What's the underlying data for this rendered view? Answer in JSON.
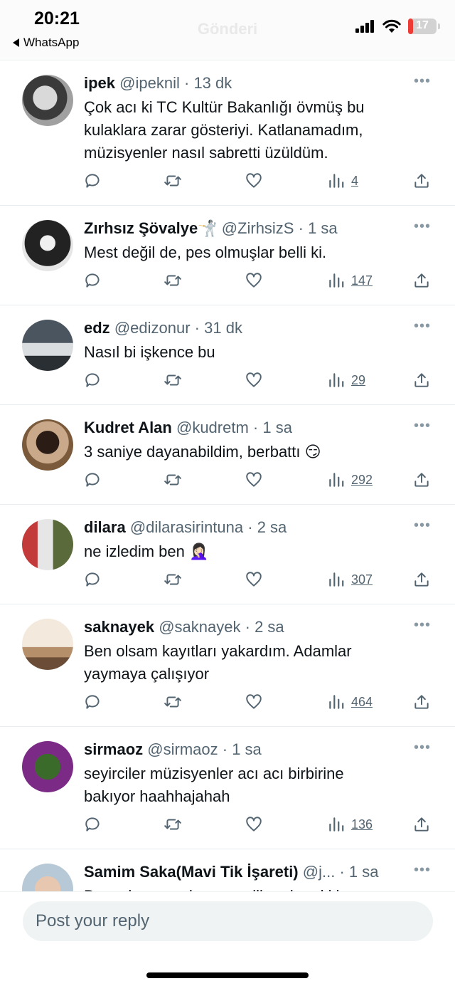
{
  "status_bar": {
    "time": "20:21",
    "back_app": "WhatsApp",
    "ghost_title": "Gönderi",
    "battery": "17",
    "battery_level": 0.17
  },
  "icons": {
    "reply": "reply-bubble-icon",
    "retweet": "retweet-icon",
    "like": "heart-icon",
    "views": "views-bar-chart-icon",
    "share": "share-upload-icon",
    "more": "more-dots-icon"
  },
  "tweets": [
    {
      "name": "ipek",
      "handle": "@ipeknil",
      "time": "13 dk",
      "lines": [
        "Çok acı ki TC Kultür Bakanlığı övmüş bu",
        "kulaklara zarar gösteriyi. Katlanamadım,",
        "müzisyenler nasıl sabretti üzüldüm."
      ],
      "views": "4"
    },
    {
      "name": "Zırhsız Şövalye🤺",
      "handle": "@ZirhsizS",
      "time": "1 sa",
      "lines": [
        "Mest değil de, pes olmuşlar belli ki."
      ],
      "views": "147"
    },
    {
      "name": "edz",
      "handle": "@edizonur",
      "time": "31 dk",
      "lines": [
        "Nasıl bi işkence bu"
      ],
      "views": "29"
    },
    {
      "name": "Kudret Alan",
      "handle": "@kudretm",
      "time": "1 sa",
      "lines": [
        "3 saniye dayanabildim, berbattı 😏"
      ],
      "views": "292"
    },
    {
      "name": "dilara",
      "handle": "@dilarasirintuna",
      "time": "2 sa",
      "lines": [
        "ne izledim ben 🤦🏻‍♀️"
      ],
      "views": "307"
    },
    {
      "name": "saknayek",
      "handle": "@saknayek",
      "time": "2 sa",
      "lines": [
        "Ben olsam kayıtları yakardım. Adamlar",
        "yaymaya çalışıyor"
      ],
      "views": "464"
    },
    {
      "name": "sirmaoz",
      "handle": "@sirmaoz",
      "time": "1 sa",
      "lines": [
        "seyirciler müzisyenler acı acı birbirine",
        "bakıyor haahhajahah"
      ],
      "views": "136"
    },
    {
      "name": "Samim Saka(Mavi Tik İşareti)",
      "handle": "@j...",
      "time": "1 sa",
      "lines": [
        "Basanlar sanadanman vill gadar aki i"
      ],
      "views": ""
    }
  ],
  "reply": {
    "placeholder": "Post your reply"
  }
}
